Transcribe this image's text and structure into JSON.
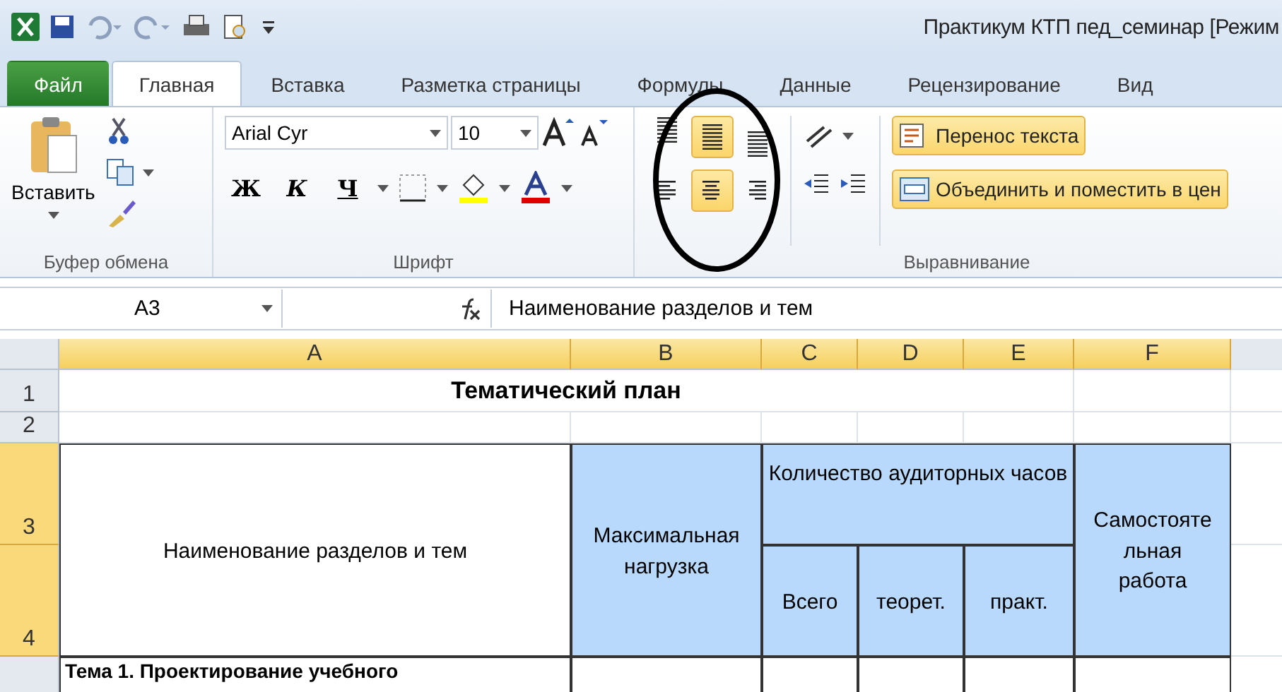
{
  "window": {
    "title": "Практикум  КТП пед_семинар  [Режим"
  },
  "tabs": [
    {
      "label": "Файл",
      "kind": "file",
      "selected": false
    },
    {
      "label": "Главная",
      "kind": "tab",
      "selected": true
    },
    {
      "label": "Вставка",
      "kind": "tab",
      "selected": false
    },
    {
      "label": "Разметка страницы",
      "kind": "tab",
      "selected": false
    },
    {
      "label": "Формулы",
      "kind": "tab",
      "selected": false
    },
    {
      "label": "Данные",
      "kind": "tab",
      "selected": false
    },
    {
      "label": "Рецензирование",
      "kind": "tab",
      "selected": false
    },
    {
      "label": "Вид",
      "kind": "tab",
      "selected": false
    }
  ],
  "ribbon": {
    "clipboard": {
      "paste_label": "Вставить",
      "group_label": "Буфер обмена"
    },
    "font": {
      "font_name": "Arial Cyr",
      "font_size": "10",
      "bold_label": "Ж",
      "italic_label": "К",
      "underline_label": "Ч",
      "group_label": "Шрифт"
    },
    "alignment": {
      "vertical": [
        {
          "kind": "top",
          "selected": false
        },
        {
          "kind": "middle",
          "selected": true
        },
        {
          "kind": "bottom",
          "selected": false
        }
      ],
      "horizontal": [
        {
          "kind": "left",
          "selected": false
        },
        {
          "kind": "center",
          "selected": true
        },
        {
          "kind": "right",
          "selected": false
        }
      ],
      "wrap_label": "Перенос текста",
      "merge_label": "Объединить и поместить в цен",
      "group_label": "Выравнивание"
    }
  },
  "formula_bar": {
    "name_box": "A3",
    "formula": "Наименование разделов и тем"
  },
  "columns": [
    {
      "label": "A",
      "selected": true
    },
    {
      "label": "B",
      "selected": true
    },
    {
      "label": "C",
      "selected": true
    },
    {
      "label": "D",
      "selected": true
    },
    {
      "label": "E",
      "selected": true
    },
    {
      "label": "F",
      "selected": true
    }
  ],
  "rows": [
    {
      "label": "1",
      "selected": false
    },
    {
      "label": "2",
      "selected": false
    },
    {
      "label": "3",
      "selected": true
    },
    {
      "label": "4",
      "selected": true
    }
  ],
  "sheet": {
    "title": "Тематический план",
    "header": {
      "name_column": "Наименование разделов и тем",
      "max_load": "Максимальная нагрузка",
      "hours_group": "Количество аудиторных часов",
      "total": "Всего",
      "theory": "теорет.",
      "practice": "практ.",
      "self_study": "Самостоятельная работа"
    },
    "first_topic": "Тема 1. Проектирование учебного"
  }
}
